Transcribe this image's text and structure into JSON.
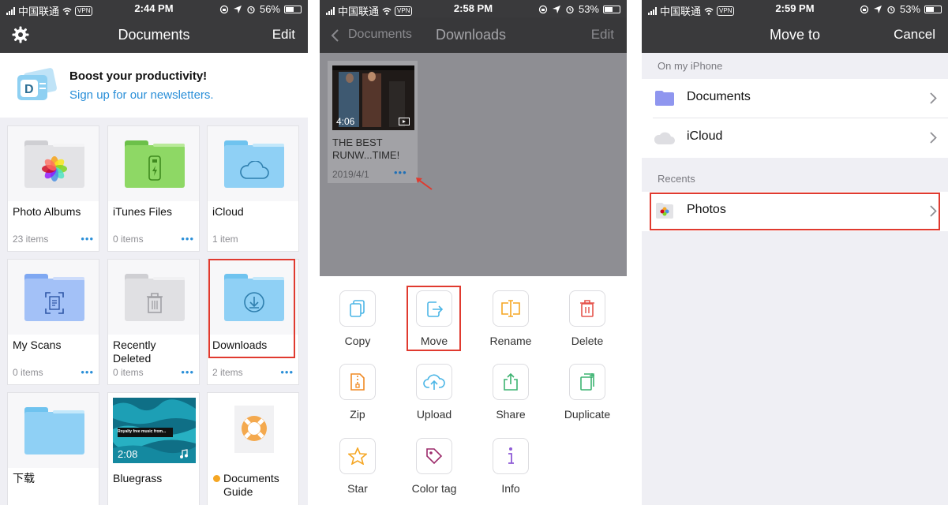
{
  "status_bars": [
    {
      "carrier": "中国联通",
      "vpn": "VPN",
      "time": "2:44 PM",
      "battery": "56%",
      "battery_level": 0.56
    },
    {
      "carrier": "中国联通",
      "vpn": "VPN",
      "time": "2:58 PM",
      "battery": "53%",
      "battery_level": 0.53
    },
    {
      "carrier": "中国联通",
      "vpn": "VPN",
      "time": "2:59 PM",
      "battery": "53%",
      "battery_level": 0.53
    }
  ],
  "screen1": {
    "nav": {
      "title": "Documents",
      "right": "Edit",
      "left_icon": "gear-icon"
    },
    "promo": {
      "heading": "Boost your productivity!",
      "link": "Sign up for our newsletters."
    },
    "tiles": [
      {
        "name": "Photo Albums",
        "count": "23 items",
        "more": "•••"
      },
      {
        "name": "iTunes Files",
        "count": "0 items",
        "more": "•••"
      },
      {
        "name": "iCloud",
        "count": "1 item",
        "more": ""
      },
      {
        "name": "My Scans",
        "count": "0 items",
        "more": "•••"
      },
      {
        "name": "Recently Deleted",
        "count": "0 items",
        "more": "•••"
      },
      {
        "name": "Downloads",
        "count": "2 items",
        "more": "•••"
      },
      {
        "name": "下载",
        "count": "",
        "more": ""
      },
      {
        "name": "Bluegrass",
        "count": "",
        "more": "",
        "duration": "2:08",
        "caption": "Royalty free music from..."
      },
      {
        "name": "Documents Guide",
        "count": "",
        "more": ""
      }
    ]
  },
  "screen2": {
    "nav": {
      "back": "Documents",
      "title": "Downloads",
      "right": "Edit"
    },
    "file": {
      "duration": "4:06",
      "title": "THE BEST RUNW...TIME!",
      "date": "2019/4/1",
      "more": "•••"
    },
    "actions": [
      {
        "label": "Copy",
        "icon": "copy-icon"
      },
      {
        "label": "Move",
        "icon": "move-icon"
      },
      {
        "label": "Rename",
        "icon": "rename-icon"
      },
      {
        "label": "Delete",
        "icon": "trash-icon"
      },
      {
        "label": "Zip",
        "icon": "zip-icon"
      },
      {
        "label": "Upload",
        "icon": "upload-icon"
      },
      {
        "label": "Share",
        "icon": "share-icon"
      },
      {
        "label": "Duplicate",
        "icon": "duplicate-icon"
      },
      {
        "label": "Star",
        "icon": "star-icon"
      },
      {
        "label": "Color tag",
        "icon": "tag-icon"
      },
      {
        "label": "Info",
        "icon": "info-icon"
      }
    ]
  },
  "screen3": {
    "nav": {
      "title": "Move to",
      "right": "Cancel"
    },
    "section_device": "On my iPhone",
    "rows_device": [
      {
        "label": "Documents",
        "icon": "folder-icon"
      },
      {
        "label": "iCloud",
        "icon": "cloud-icon"
      }
    ],
    "section_recents": "Recents",
    "rows_recents": [
      {
        "label": "Photos",
        "icon": "photos-folder-icon"
      }
    ]
  },
  "colors": {
    "nav_bg": "#3a3a3c",
    "accent": "#2a8fd8",
    "highlight": "#e03a2f",
    "folder_blue": "#8fd0f5",
    "folder_green": "#8ed865",
    "folder_gray": "#d9d9dc"
  }
}
